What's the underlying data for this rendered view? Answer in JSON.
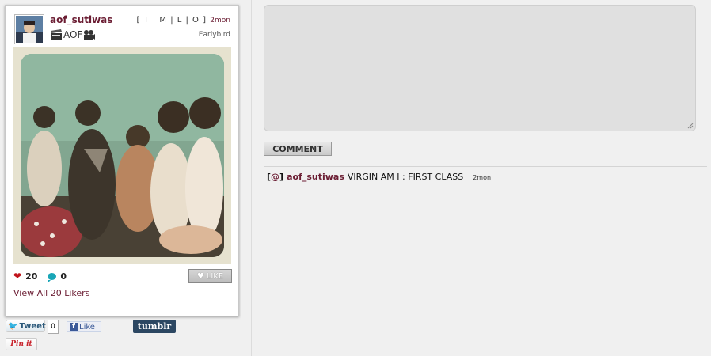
{
  "post": {
    "username": "aof_sutiwas",
    "caption": "AOF",
    "caption_icons": [
      "clapperboard-icon",
      "movie-camera-icon"
    ],
    "menu": "[ T | M | L | O ]",
    "time": "2mon",
    "filter": "Earlybird",
    "likes": "20",
    "comments": "0",
    "like_button": "LIKE",
    "view_likers": "View All 20 Likers"
  },
  "share": {
    "tweet_label": "Tweet",
    "tweet_count": "0",
    "fb_like_label": "Like",
    "tumblr_label": "tumblr",
    "pinit_label": "Pin it"
  },
  "comment_form": {
    "textarea_value": "",
    "submit_label": "COMMENT"
  },
  "comments_list": [
    {
      "mention_open": "[",
      "mention_at": "@",
      "mention_close": "]",
      "user": "aof_sutiwas",
      "text": "VIRGIN AM I : FIRST CLASS",
      "time": "2mon"
    }
  ],
  "colors": {
    "accent": "#6b1d33",
    "heart": "#c0131a",
    "comment_bubble": "#1aa6b7",
    "tumblr": "#2c4762",
    "page_bg": "#f0f0f0"
  }
}
